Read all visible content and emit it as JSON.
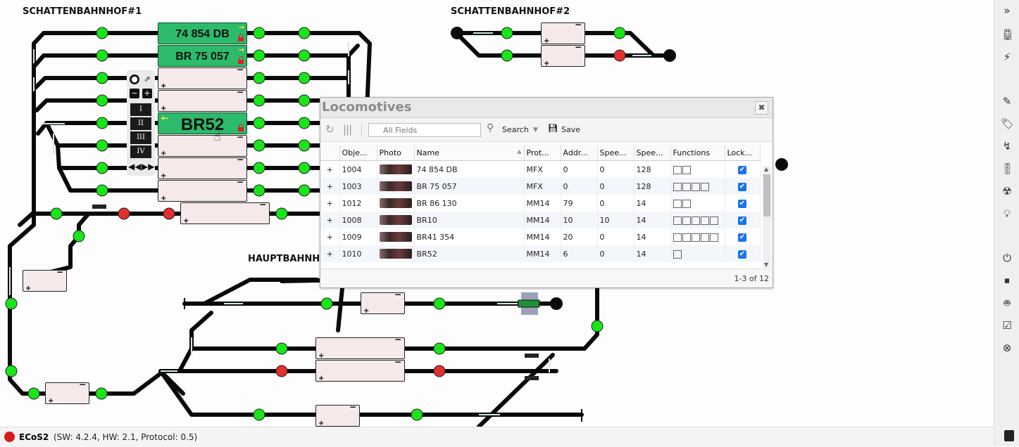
{
  "layout_labels": {
    "station1": "SCHATTENBAHNHOF#1",
    "station2": "SCHATTENBAHNHOF#2",
    "station3": "HAUPTBAHNHOF"
  },
  "blocks": {
    "loco1": "74 854 DB",
    "loco2": "BR 75 057",
    "loco3": "BR52"
  },
  "control": {
    "routes": [
      "I",
      "II",
      "III",
      "IV"
    ]
  },
  "dialog": {
    "title": "Locomotives",
    "search_placeholder": "All Fields",
    "search_label": "Search",
    "save_label": "Save",
    "columns": [
      "Obje...",
      "Photo",
      "Name",
      "Prot...",
      "Addr...",
      "Spee...",
      "Spee...",
      "Functions",
      "Lock..."
    ],
    "rows": [
      {
        "expand": "+",
        "id": "1004",
        "name": "74 854 DB",
        "protocol": "MFX",
        "address": "0",
        "speed": "0",
        "speedsteps": "128",
        "functions": 2,
        "locked": true
      },
      {
        "expand": "+",
        "id": "1003",
        "name": "BR 75 057",
        "protocol": "MFX",
        "address": "0",
        "speed": "0",
        "speedsteps": "128",
        "functions": 4,
        "locked": true
      },
      {
        "expand": "+",
        "id": "1012",
        "name": "BR 86 130",
        "protocol": "MM14",
        "address": "79",
        "speed": "0",
        "speedsteps": "14",
        "functions": 2,
        "locked": true
      },
      {
        "expand": "+",
        "id": "1008",
        "name": "BR10",
        "protocol": "MM14",
        "address": "10",
        "speed": "10",
        "speedsteps": "14",
        "functions": 5,
        "locked": true
      },
      {
        "expand": "+",
        "id": "1009",
        "name": "BR41 354",
        "protocol": "MM14",
        "address": "20",
        "speed": "0",
        "speedsteps": "14",
        "functions": 5,
        "locked": true
      },
      {
        "expand": "+",
        "id": "1010",
        "name": "BR52",
        "protocol": "MM14",
        "address": "6",
        "speed": "0",
        "speedsteps": "14",
        "functions": 1,
        "locked": true
      }
    ],
    "paging": "1-3 of 12"
  },
  "status": {
    "name": "ECoS2",
    "info": "(SW: 4.2.4, HW: 2.1, Protocol: 0.5)",
    "color": "#d91a1a"
  },
  "colors": {
    "occupied_block": "#2dba6b",
    "signal_green": "#19e619",
    "signal_red": "#e23030"
  },
  "sidebar_icons": [
    "collapse-icon",
    "train-icon",
    "wand-icon",
    "edit-icon",
    "tags-icon",
    "route-icon",
    "traffic-light-icon",
    "s88-icon",
    "bulb-icon",
    "power-icon",
    "stop-icon",
    "robot-icon",
    "tasks-icon",
    "close-circle-icon"
  ]
}
